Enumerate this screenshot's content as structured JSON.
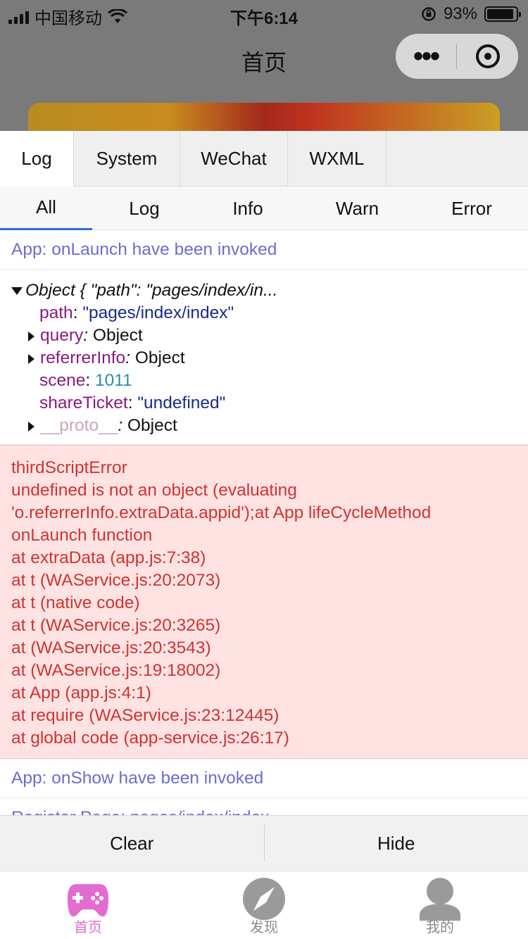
{
  "status_bar": {
    "carrier": "中国移动",
    "time": "下午6:14",
    "battery": "93%",
    "battery_level": 0.93
  },
  "nav": {
    "title": "首页"
  },
  "console": {
    "tabs": [
      {
        "label": "Log",
        "active": true
      },
      {
        "label": "System",
        "active": false
      },
      {
        "label": "WeChat",
        "active": false
      },
      {
        "label": "WXML",
        "active": false
      }
    ],
    "filters": [
      {
        "label": "All",
        "active": true
      },
      {
        "label": "Log",
        "active": false
      },
      {
        "label": "Info",
        "active": false
      },
      {
        "label": "Warn",
        "active": false
      },
      {
        "label": "Error",
        "active": false
      }
    ],
    "entries": {
      "launch": "App: onLaunch have been invoked",
      "object": {
        "summary": "Object { \"path\": \"pages/index/in...",
        "path_key": "path",
        "path_value": "\"pages/index/index\"",
        "query_key": "query",
        "query_value": "Object",
        "referrer_key": "referrerInfo",
        "referrer_value": "Object",
        "scene_key": "scene",
        "scene_value": "1011",
        "share_key": "shareTicket",
        "share_value": "\"undefined\"",
        "proto_key": "__proto__",
        "proto_value": "Object"
      },
      "error_lines": [
        "thirdScriptError",
        "undefined is not an object (evaluating",
        "'o.referrerInfo.extraData.appid');at App lifeCycleMethod",
        "onLaunch function",
        "at extraData (app.js:7:38)",
        "at t (WAService.js:20:2073)",
        "at t (native code)",
        "at t (WAService.js:20:3265)",
        "at (WAService.js:20:3543)",
        "at (WAService.js:19:18002)",
        "at App (app.js:4:1)",
        "at require (WAService.js:23:12445)",
        "at global code (app-service.js:26:17)"
      ],
      "show": "App: onShow have been invoked",
      "cut": "Register Page: pages/index/index"
    },
    "buttons": {
      "clear": "Clear",
      "hide": "Hide"
    }
  },
  "tabbar": {
    "items": [
      {
        "label": "首页",
        "icon": "gamepad-icon",
        "active": true
      },
      {
        "label": "发现",
        "icon": "compass-icon",
        "active": false
      },
      {
        "label": "我的",
        "icon": "user-icon",
        "active": false
      }
    ]
  },
  "colors": {
    "info_text": "#6b6bd0",
    "error_text": "#d23232",
    "error_bg": "#ffe3e3",
    "active_tab_underline": "#2e6fd8",
    "tabbar_active": "#e46bd0"
  }
}
